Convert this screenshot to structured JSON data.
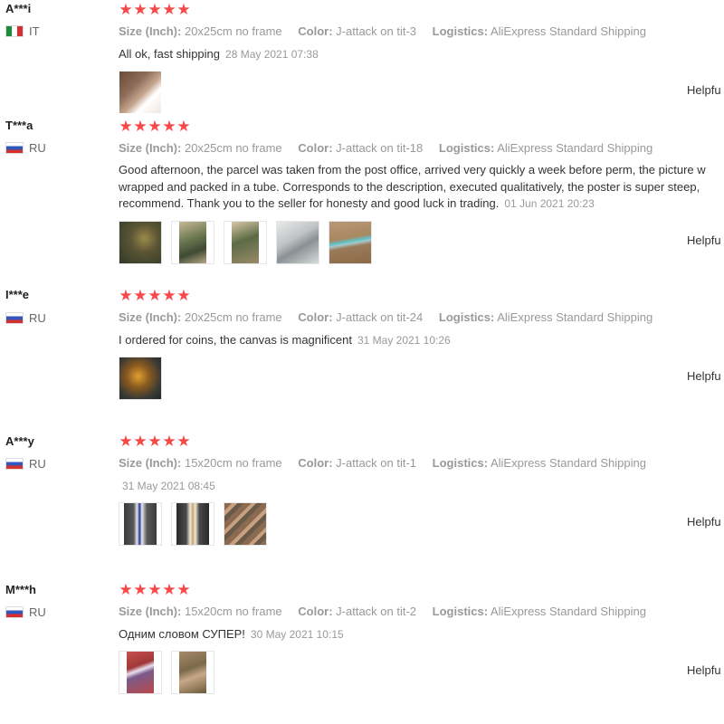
{
  "labels": {
    "size": "Size (Inch):",
    "color": "Color:",
    "logistics": "Logistics:",
    "helpful": "Helpfu"
  },
  "reviews": [
    {
      "user": "A***i",
      "country": "IT",
      "flag": "it-flag-icon",
      "rating": 5,
      "size": "20x25cm no frame",
      "color": "J-attack on tit-3",
      "logistics": "AliExpress Standard Shipping",
      "text": "All ok, fast shipping",
      "date": "28 May 2021 07:38",
      "photos": [
        "review-photo"
      ]
    },
    {
      "user": "T***a",
      "country": "RU",
      "flag": "ru-flag-icon",
      "rating": 5,
      "size": "20x25cm no frame",
      "color": "J-attack on tit-18",
      "logistics": "AliExpress Standard Shipping",
      "text_lines": [
        "Good afternoon, the parcel was taken from the post office, arrived very quickly a week before perm, the picture w",
        "wrapped and packed in a tube. Corresponds to the description, executed qualitatively, the poster is super steep,",
        "recommend. Thank you to the seller for honesty and good luck in trading."
      ],
      "date": "01 Jun 2021 20:23",
      "photos": [
        "review-photo",
        "review-photo",
        "review-photo",
        "review-photo",
        "review-photo"
      ]
    },
    {
      "user": "I***e",
      "country": "RU",
      "flag": "ru-flag-icon",
      "rating": 5,
      "size": "20x25cm no frame",
      "color": "J-attack on tit-24",
      "logistics": "AliExpress Standard Shipping",
      "text": "I ordered for coins, the canvas is magnificent",
      "date": "31 May 2021 10:26",
      "photos": [
        "review-photo"
      ]
    },
    {
      "user": "A***y",
      "country": "RU",
      "flag": "ru-flag-icon",
      "rating": 5,
      "size": "15x20cm no frame",
      "color": "J-attack on tit-1",
      "logistics": "AliExpress Standard Shipping",
      "text": "",
      "date": "31 May 2021 08:45",
      "photos": [
        "review-photo",
        "review-photo",
        "review-photo"
      ]
    },
    {
      "user": "M***h",
      "country": "RU",
      "flag": "ru-flag-icon",
      "rating": 5,
      "size": "15x20cm no frame",
      "color": "J-attack on tit-2",
      "logistics": "AliExpress Standard Shipping",
      "text": "Одним словом СУПЕР!",
      "date": "30 May 2021 10:15",
      "photos": [
        "review-photo",
        "review-photo"
      ]
    }
  ],
  "colors": {
    "star": "#f54849",
    "muted": "#999999",
    "text": "#333333"
  }
}
